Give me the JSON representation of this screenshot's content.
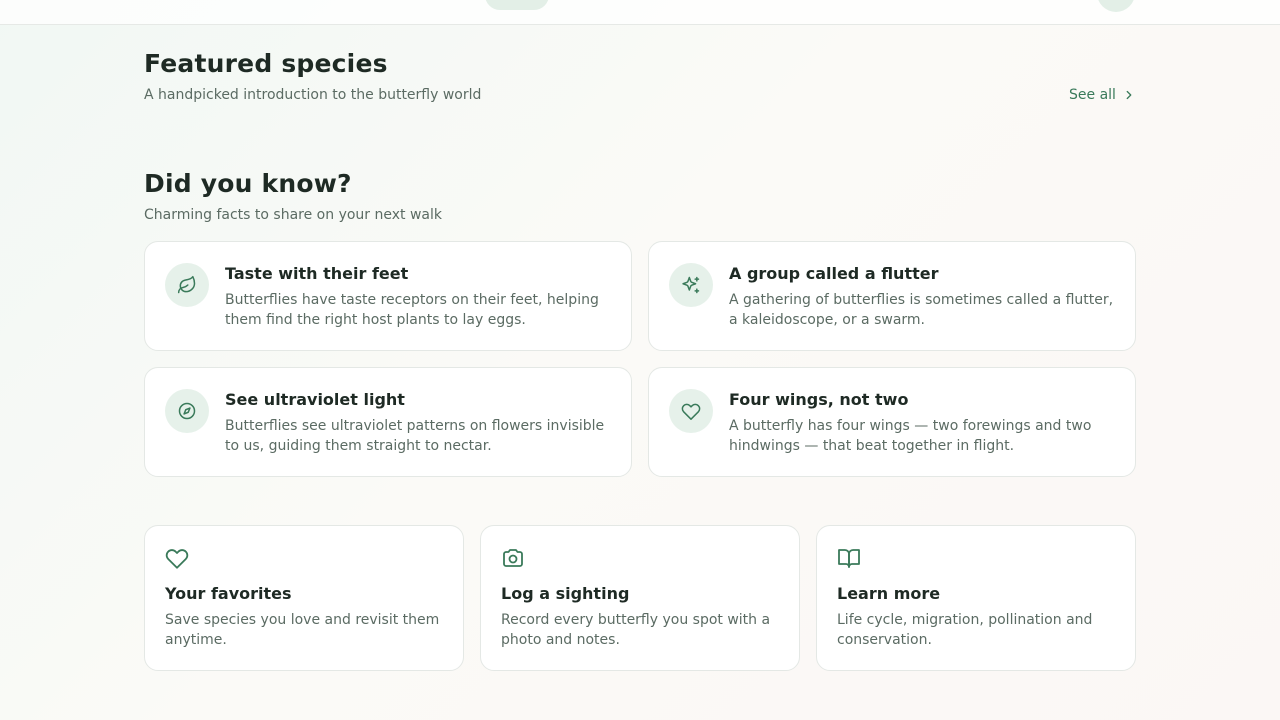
{
  "colors": {
    "accent": "#3a7a5a",
    "icon_bg": "#e6f1ea",
    "text_primary": "#1e2a24",
    "text_secondary": "#5b6b63"
  },
  "featured": {
    "title": "Featured species",
    "subtitle": "A handpicked introduction to the butterfly world",
    "see_all": "See all"
  },
  "facts": {
    "title": "Did you know?",
    "subtitle": "Charming facts to share on your next walk",
    "items": [
      {
        "icon": "leaf-icon",
        "title": "Taste with their feet",
        "text": "Butterflies have taste receptors on their feet, helping them find the right host plants to lay eggs."
      },
      {
        "icon": "sparkles-icon",
        "title": "A group called a flutter",
        "text": "A gathering of butterflies is sometimes called a flutter, a kaleidoscope, or a swarm."
      },
      {
        "icon": "compass-icon",
        "title": "See ultraviolet light",
        "text": "Butterflies see ultraviolet patterns on flowers invisible to us, guiding them straight to nectar."
      },
      {
        "icon": "heart-icon",
        "title": "Four wings, not two",
        "text": "A butterfly has four wings — two forewings and two hindwings — that beat together in flight."
      }
    ]
  },
  "features": [
    {
      "icon": "heart-icon",
      "title": "Your favorites",
      "text": "Save species you love and revisit them anytime."
    },
    {
      "icon": "camera-icon",
      "title": "Log a sighting",
      "text": "Record every butterfly you spot with a photo and notes."
    },
    {
      "icon": "book-open-icon",
      "title": "Learn more",
      "text": "Life cycle, migration, pollination and conservation."
    }
  ]
}
